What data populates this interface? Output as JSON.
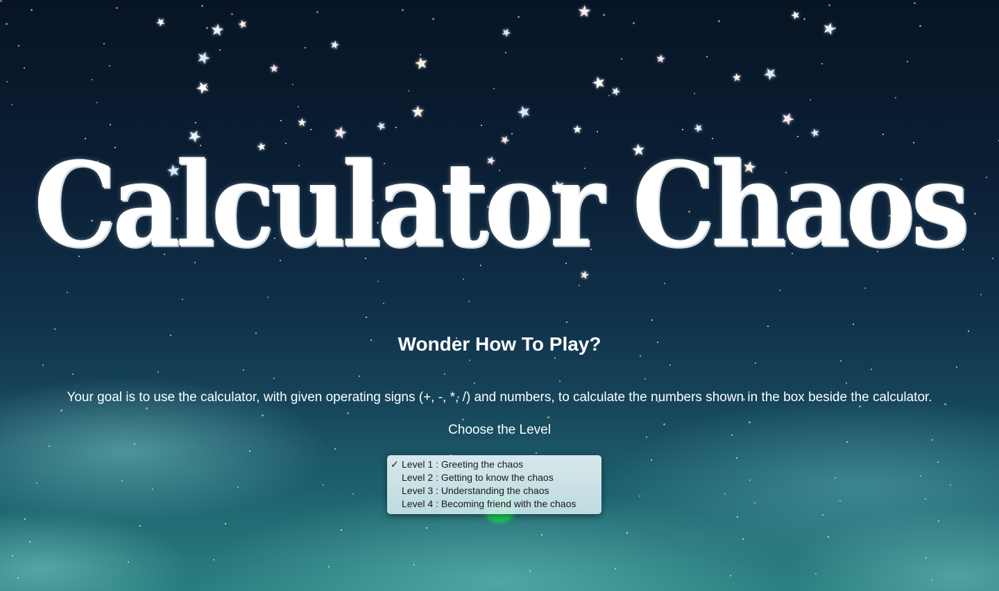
{
  "title": "Calculator Chaos",
  "heading": "Wonder How To Play?",
  "instructions": "Your goal is to use the calculator, with given operating signs (+, -, *, /) and numbers, to calculate the numbers shown in the box beside the calculator.",
  "choose_label": "Choose the Level",
  "level_menu": {
    "options": [
      "Level 1 : Greeting the chaos",
      "Level 2 : Getting to know the chaos",
      "Level 3 : Understanding the chaos",
      "Level 4 : Becoming friend with the chaos"
    ],
    "check_glyph": "✓",
    "check_icon": "checkmark-icon"
  },
  "decoration": {
    "star_icon": "sparkle-star-icon",
    "star_glyph": "★"
  },
  "colors": {
    "start_button": "#10b34a",
    "text": "#ffffff"
  }
}
